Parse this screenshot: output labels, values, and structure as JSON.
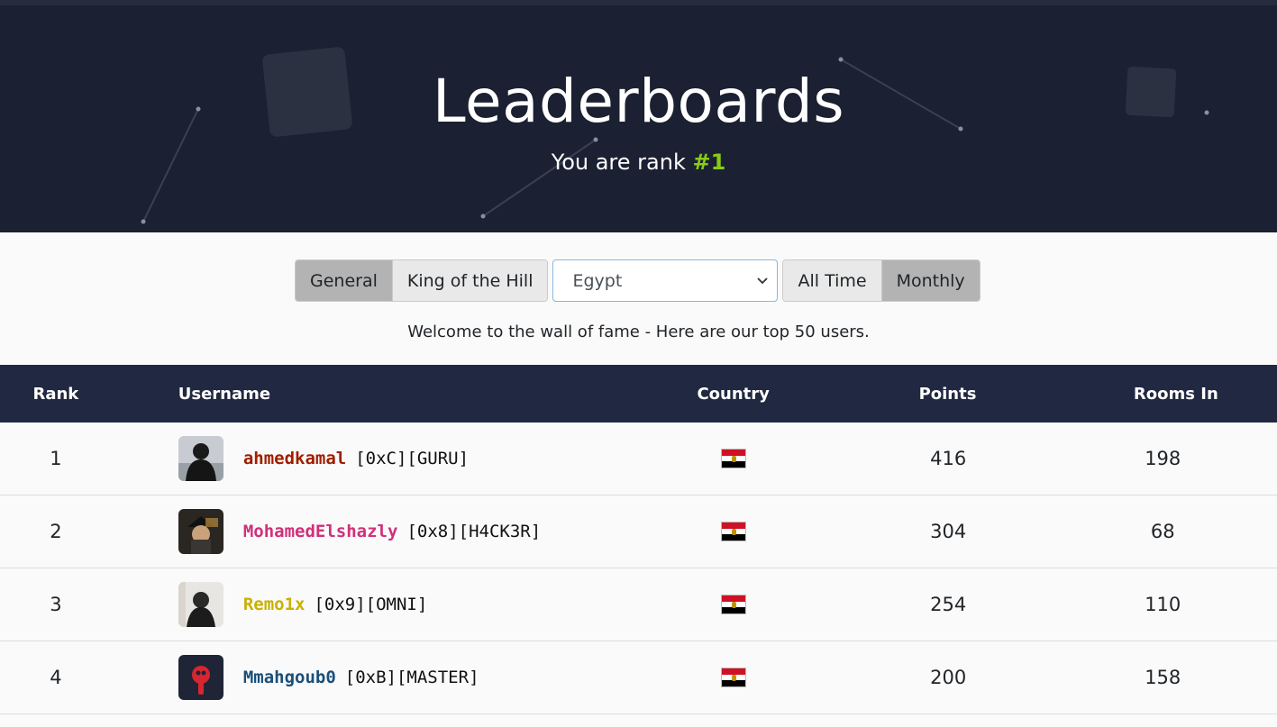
{
  "hero": {
    "title": "Leaderboards",
    "rank_prefix": "You are rank ",
    "rank_value": "#1"
  },
  "tabs": [
    {
      "label": "General",
      "active": true
    },
    {
      "label": "King of the Hill",
      "active": false
    }
  ],
  "country_select": {
    "selected": "Egypt"
  },
  "period_tabs": [
    {
      "label": "All Time",
      "active": false
    },
    {
      "label": "Monthly",
      "active": true
    }
  ],
  "welcome_text": "Welcome to the wall of fame - Here are our top 50 users.",
  "table": {
    "headers": {
      "rank": "Rank",
      "username": "Username",
      "country": "Country",
      "points": "Points",
      "rooms": "Rooms In"
    },
    "rows": [
      {
        "rank": "1",
        "name": "ahmedkamal",
        "tag": "[0xC][GURU]",
        "name_color": "#a01e00",
        "country": "Egypt",
        "points": "416",
        "rooms": "198"
      },
      {
        "rank": "2",
        "name": "MohamedElshazly",
        "tag": "[0x8][H4CK3R]",
        "name_color": "#d0307a",
        "country": "Egypt",
        "points": "304",
        "rooms": "68"
      },
      {
        "rank": "3",
        "name": "Remo1x",
        "tag": "[0x9][OMNI]",
        "name_color": "#c9b100",
        "country": "Egypt",
        "points": "254",
        "rooms": "110"
      },
      {
        "rank": "4",
        "name": "Mmahgoub0",
        "tag": "[0xB][MASTER]",
        "name_color": "#1a4f7a",
        "country": "Egypt",
        "points": "200",
        "rooms": "158"
      }
    ]
  },
  "colors": {
    "hero_bg": "#1b2032",
    "table_header_bg": "#212841",
    "rank_accent": "#88cc14"
  }
}
